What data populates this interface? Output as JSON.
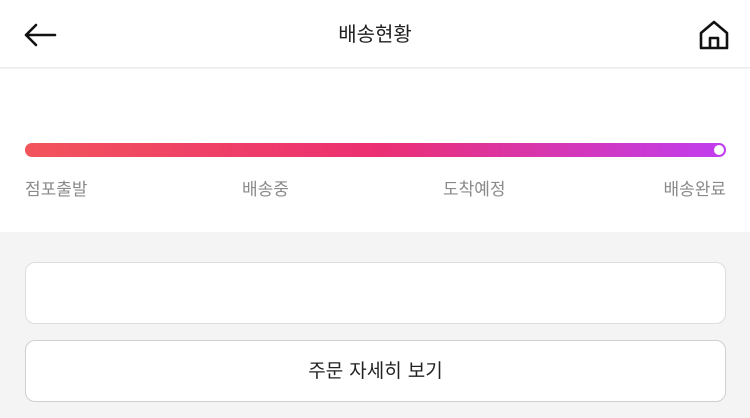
{
  "header": {
    "title": "배송현황",
    "back_icon": "arrow-left-icon",
    "home_icon": "home-icon"
  },
  "progress": {
    "fraction": 1.0,
    "colors": {
      "start": "#f2545b",
      "middle": "#ec2f72",
      "end": "#c03df0",
      "track": "#eeeeee"
    },
    "steps": [
      {
        "label": "점포출발"
      },
      {
        "label": "배송중"
      },
      {
        "label": "도착예정"
      },
      {
        "label": "배송완료"
      }
    ]
  },
  "actions": {
    "order_detail_label": "주문 자세히 보기"
  }
}
